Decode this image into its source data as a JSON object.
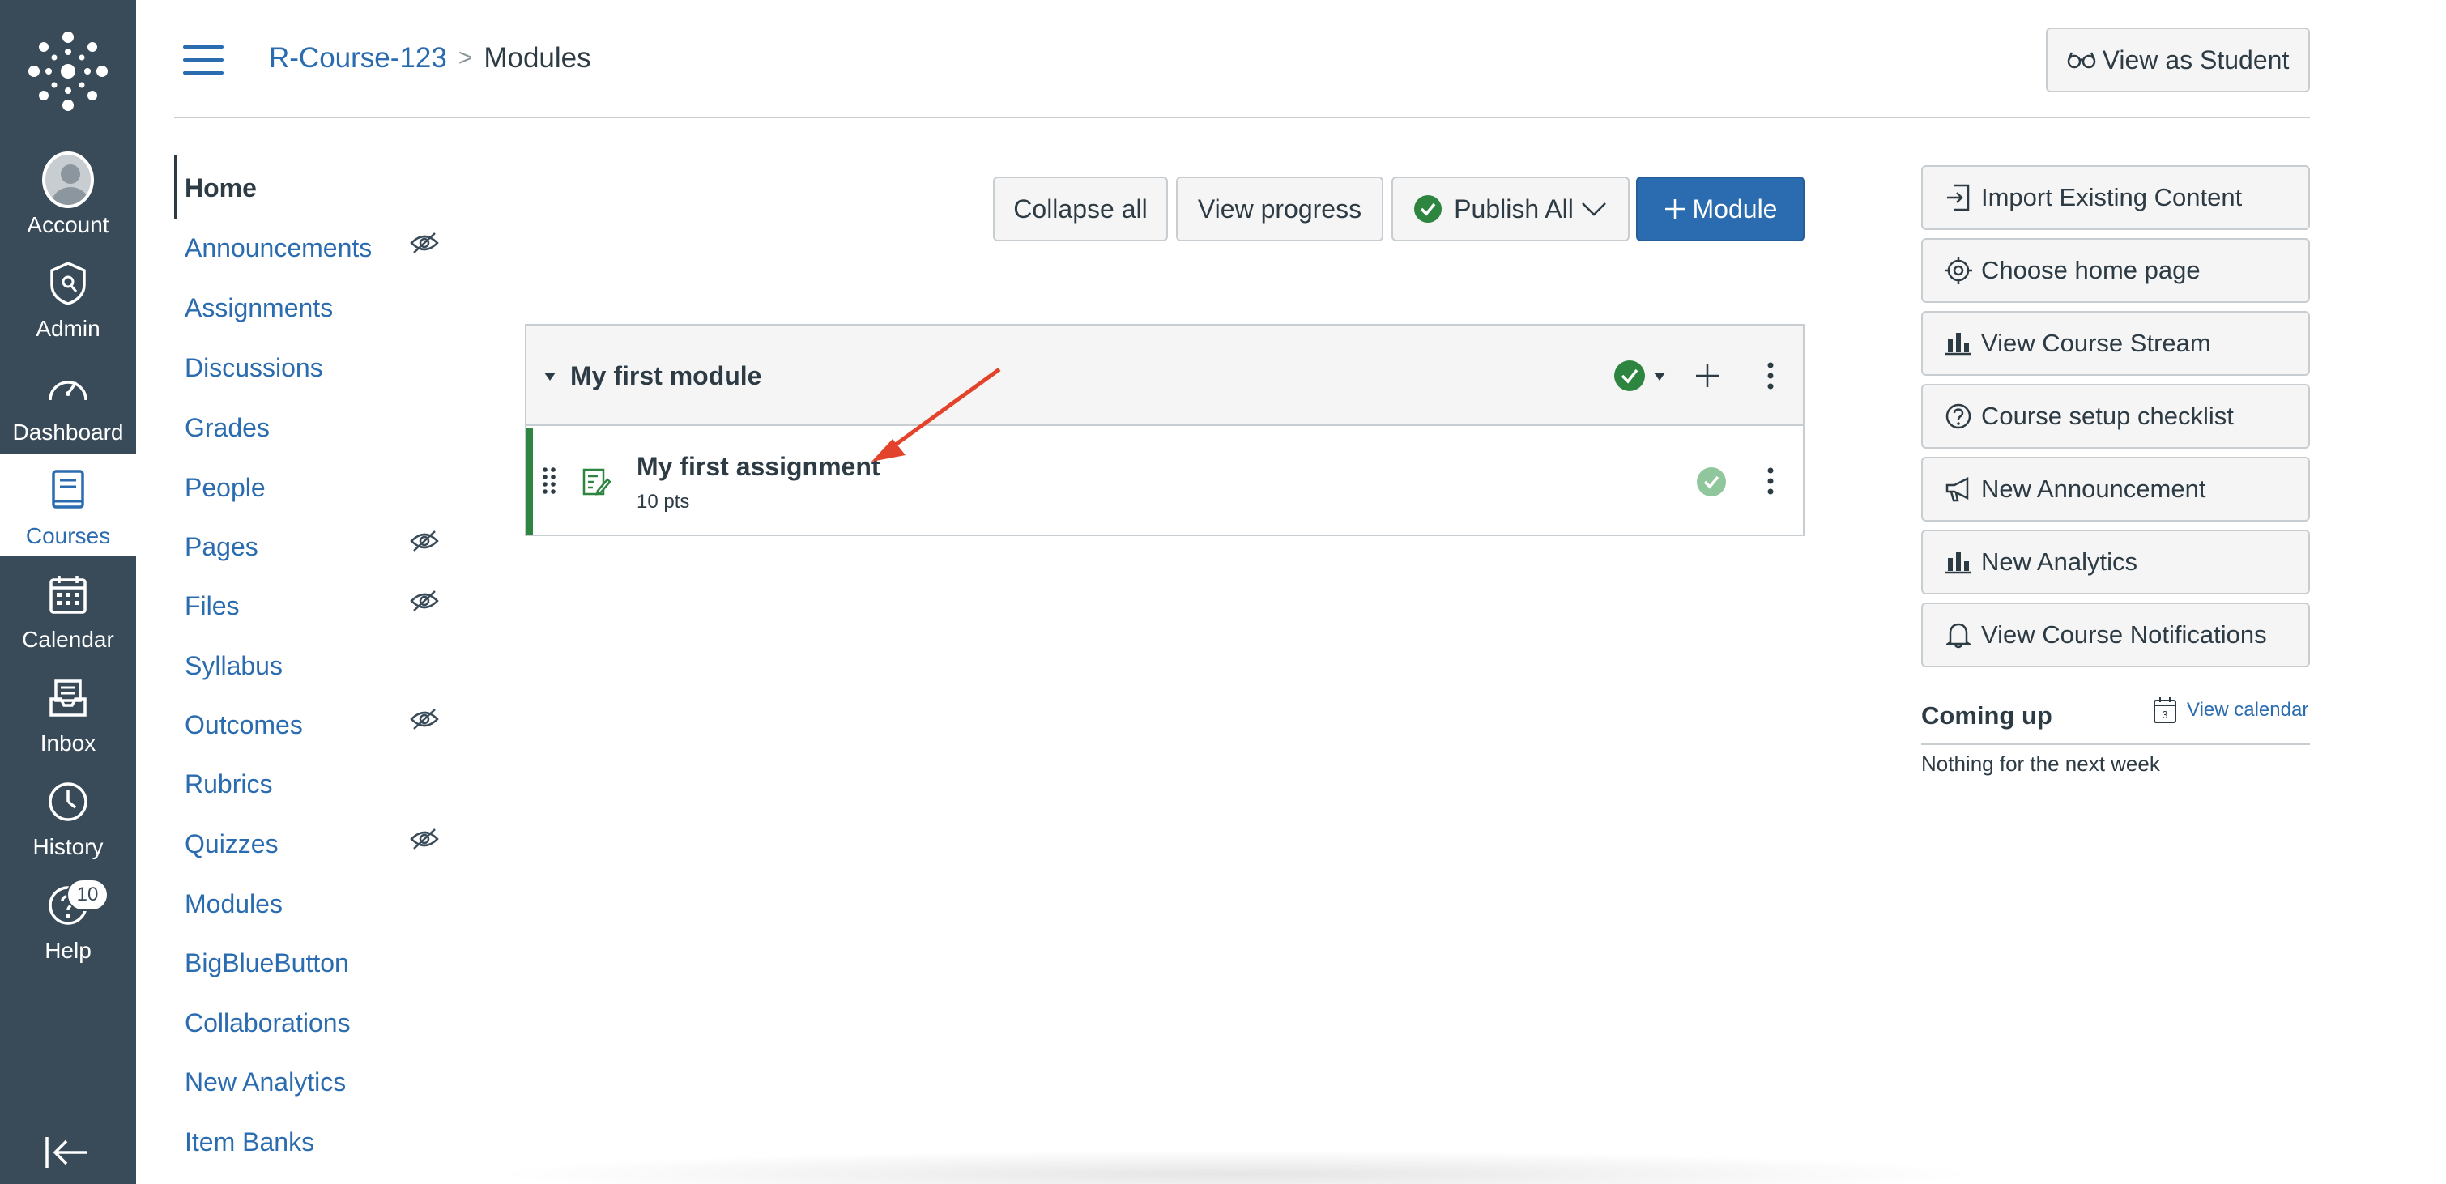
{
  "global_nav": {
    "items": [
      {
        "label": "Account",
        "icon": "account-avatar"
      },
      {
        "label": "Admin",
        "icon": "shield-icon"
      },
      {
        "label": "Dashboard",
        "icon": "dashboard-icon"
      },
      {
        "label": "Courses",
        "icon": "book-icon",
        "active": true
      },
      {
        "label": "Calendar",
        "icon": "calendar-icon"
      },
      {
        "label": "Inbox",
        "icon": "inbox-icon"
      },
      {
        "label": "History",
        "icon": "clock-icon"
      },
      {
        "label": "Help",
        "icon": "help-icon",
        "badge": "10"
      }
    ],
    "collapse_icon": "collapse-arrow-icon"
  },
  "header": {
    "breadcrumb_course": "R-Course-123",
    "breadcrumb_separator": ">",
    "breadcrumb_current": "Modules",
    "view_as_student": "View as Student"
  },
  "course_nav": {
    "items": [
      {
        "label": "Home",
        "active": true
      },
      {
        "label": "Announcements",
        "hidden": true
      },
      {
        "label": "Assignments"
      },
      {
        "label": "Discussions"
      },
      {
        "label": "Grades"
      },
      {
        "label": "People"
      },
      {
        "label": "Pages",
        "hidden": true
      },
      {
        "label": "Files",
        "hidden": true
      },
      {
        "label": "Syllabus"
      },
      {
        "label": "Outcomes",
        "hidden": true
      },
      {
        "label": "Rubrics"
      },
      {
        "label": "Quizzes",
        "hidden": true
      },
      {
        "label": "Modules"
      },
      {
        "label": "BigBlueButton"
      },
      {
        "label": "Collaborations"
      },
      {
        "label": "New Analytics"
      },
      {
        "label": "Item Banks"
      }
    ]
  },
  "toolbar": {
    "collapse_all": "Collapse all",
    "view_progress": "View progress",
    "publish_all": "Publish All",
    "add_module": "Module"
  },
  "module": {
    "title": "My first module",
    "items": [
      {
        "title": "My first assignment",
        "points": "10 pts",
        "type": "assignment-icon",
        "published": true
      }
    ]
  },
  "sidebar": {
    "buttons": [
      {
        "label": "Import Existing Content",
        "icon": "import-icon"
      },
      {
        "label": "Choose home page",
        "icon": "target-icon"
      },
      {
        "label": "View Course Stream",
        "icon": "bar-chart-icon"
      },
      {
        "label": "Course setup checklist",
        "icon": "question-circle-icon"
      },
      {
        "label": "New Announcement",
        "icon": "megaphone-icon"
      },
      {
        "label": "New Analytics",
        "icon": "bar-chart-icon"
      },
      {
        "label": "View Course Notifications",
        "icon": "bell-icon"
      }
    ],
    "coming_up_title": "Coming up",
    "view_calendar": "View calendar",
    "calendar_day": "3",
    "nothing_text": "Nothing for the next week"
  },
  "colors": {
    "nav_bg": "#394b58",
    "link": "#2b6cb0",
    "primary_button": "#2b6cb0",
    "published_green": "#2e8540",
    "arrow_red": "#e3432b"
  }
}
